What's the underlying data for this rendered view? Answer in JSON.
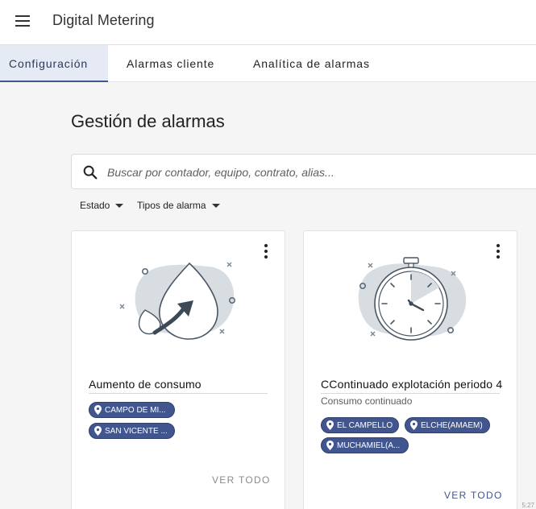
{
  "app": {
    "title": "Digital Metering"
  },
  "tabs": [
    {
      "label": "Configuración",
      "active": true
    },
    {
      "label": "Alarmas cliente",
      "active": false
    },
    {
      "label": "Analítica de alarmas",
      "active": false
    }
  ],
  "page": {
    "title": "Gestión de alarmas"
  },
  "search": {
    "placeholder": "Buscar por contador, equipo, contrato, alias..."
  },
  "filters": [
    {
      "label": "Estado"
    },
    {
      "label": "Tipos de alarma"
    }
  ],
  "cards": [
    {
      "title": "Aumento de consumo",
      "subtitle": "",
      "chips": [
        "CAMPO DE MI...",
        "SAN VICENTE ..."
      ],
      "action": "VER TODO",
      "illustration": "water-drop-increase-icon"
    },
    {
      "title": "CContinuado explotación periodo 4",
      "subtitle": "Consumo continuado",
      "chips": [
        "EL CAMPELLO",
        "ELCHE(AMAEM)",
        "MUCHAMIEL(A..."
      ],
      "action": "VER TODO",
      "illustration": "stopwatch-icon"
    }
  ],
  "footer": {
    "corner_text": "5:27"
  },
  "colors": {
    "primary": "#41558f",
    "tab_active_bg": "#e6eaf4",
    "blob": "#d8dde2",
    "background": "#f5f5f5"
  }
}
